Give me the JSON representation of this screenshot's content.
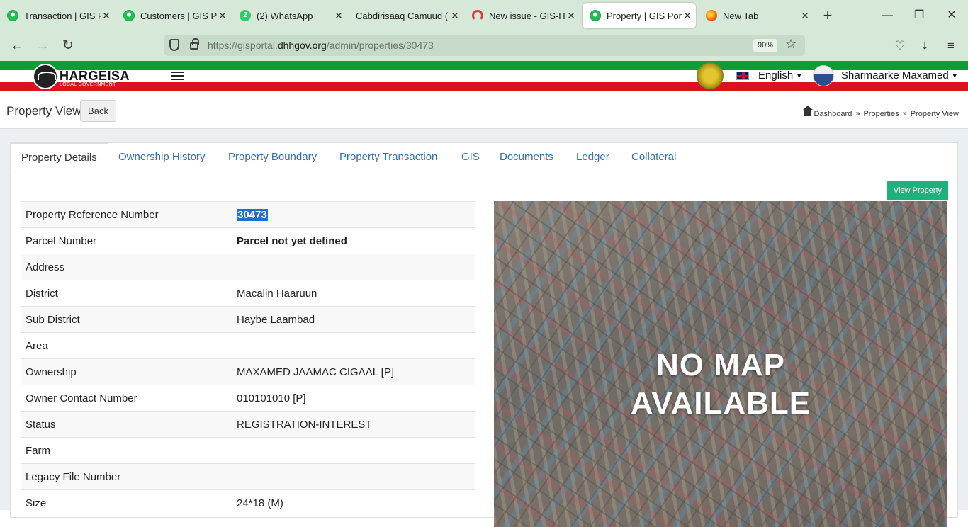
{
  "browser": {
    "tabs": [
      {
        "title": "Transaction | GIS Por",
        "icon": "gis-favicon"
      },
      {
        "title": "Customers | GIS Por",
        "icon": "gis-favicon"
      },
      {
        "title": "(2) WhatsApp",
        "icon": "whatsapp-favicon",
        "badge": "2"
      },
      {
        "title": "Cabdirisaaq Camuud (Te",
        "icon": "none"
      },
      {
        "title": "New issue - GIS-Har",
        "icon": "github-favicon"
      },
      {
        "title": "Property | GIS Portal",
        "icon": "gis-favicon",
        "active": true
      },
      {
        "title": "New Tab",
        "icon": "firefox-favicon"
      }
    ],
    "url_prefix": "https://gisportal.",
    "url_domain": "dhhgov.org",
    "url_path": "/admin/properties/30473",
    "zoom": "90%"
  },
  "header": {
    "logo_name": "HARGEISA",
    "logo_subtitle": "LOCAL GOVERNMENT",
    "language": "English",
    "user_name": "Sharmaarke Maxamed"
  },
  "page": {
    "title": "Property View",
    "back_label": "Back",
    "breadcrumb": [
      "Dashboard",
      "Properties",
      "Property View"
    ]
  },
  "tabs": [
    "Property Details",
    "Ownership History",
    "Property Boundary",
    "Property Transaction",
    "GIS",
    "Documents",
    "Ledger",
    "Collateral"
  ],
  "view_property_label": "View Property",
  "details": [
    {
      "label": "Property Reference Number",
      "value": "30473"
    },
    {
      "label": "Parcel Number",
      "value": "Parcel not yet defined"
    },
    {
      "label": "Address",
      "value": ""
    },
    {
      "label": "District",
      "value": "Macalin Haaruun"
    },
    {
      "label": "Sub District",
      "value": "Haybe Laambad"
    },
    {
      "label": "Area",
      "value": ""
    },
    {
      "label": "Ownership",
      "value": "MAXAMED JAAMAC CIGAAL [P]"
    },
    {
      "label": "Owner Contact Number",
      "value": "010101010 [P]"
    },
    {
      "label": "Status",
      "value": "REGISTRATION-INTEREST"
    },
    {
      "label": "Farm",
      "value": ""
    },
    {
      "label": "Legacy File Number",
      "value": ""
    },
    {
      "label": "Size",
      "value": "24*18 (M)"
    }
  ],
  "map": {
    "line1": "NO MAP",
    "line2": "AVAILABLE"
  },
  "colors": {
    "accent_green": "#1db17e",
    "link_blue": "#2f6fb1",
    "flag_green": "#0d9c3a",
    "flag_red": "#e1101f"
  }
}
